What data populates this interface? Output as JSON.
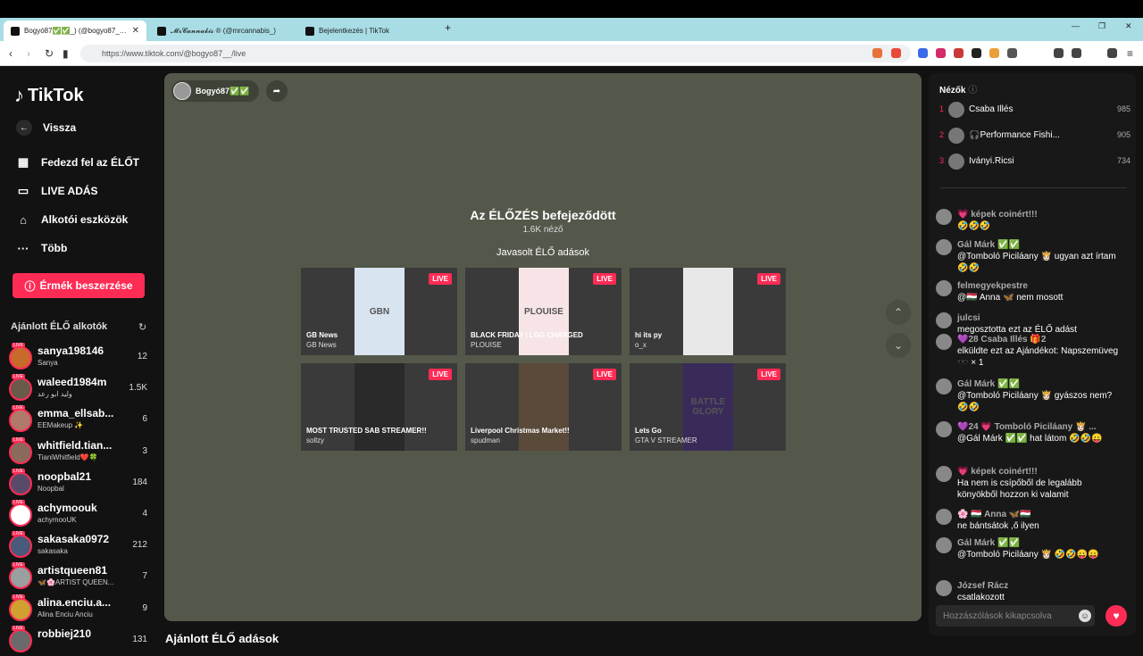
{
  "browser": {
    "tabs": [
      {
        "label": "Bogyó87✅✅_) (@bogyo87_) É"
      },
      {
        "label": "𝓜𝓻𝓒𝓪𝓷𝓷𝓪𝓫𝓲𝓼 ® (@mrcannabis_)"
      },
      {
        "label": "Bejelentkezés | TikTok"
      }
    ],
    "url": "https://www.tiktok.com/@bogyo87__/live"
  },
  "sidebar": {
    "logo": "TikTok",
    "back": "Vissza",
    "nav": [
      "Fedezd fel az ÉLŐT",
      "LIVE ADÁS",
      "Alkotói eszközök",
      "Több"
    ],
    "coins_button": "Érmék beszerzése",
    "recommended_heading": "Ajánlott ÉLŐ alkotók",
    "creators": [
      {
        "name": "sanya198146",
        "sub": "Sanya",
        "count": "12",
        "color": "#c86a2a"
      },
      {
        "name": "waleed1984m",
        "sub": "وليد ابو رعد",
        "count": "1.5K",
        "color": "#6a5a4a"
      },
      {
        "name": "emma_ellsab...",
        "sub": "EEMakeup ✨",
        "count": "6",
        "color": "#b07a6a"
      },
      {
        "name": "whitfield.tian...",
        "sub": "TianiWhitfield❤️🍀",
        "count": "3",
        "color": "#8a6a5a"
      },
      {
        "name": "noopbal21",
        "sub": "Noopbal",
        "count": "184",
        "color": "#5a4a6a"
      },
      {
        "name": "achymoouk",
        "sub": "achymooUK",
        "count": "4",
        "color": "#ffffff"
      },
      {
        "name": "sakasaka0972",
        "sub": "sakasaka",
        "count": "212",
        "color": "#4a5a7a"
      },
      {
        "name": "artistqueen81",
        "sub": "🦋🌸ARTIST QUEEN...",
        "count": "7",
        "color": "#9aa0a0"
      },
      {
        "name": "alina.enciu.a...",
        "sub": "Alina Enciu Anciu",
        "count": "9",
        "color": "#d0a030"
      },
      {
        "name": "robbiej210",
        "sub": "",
        "count": "131",
        "color": "#6a6a6a"
      }
    ]
  },
  "player": {
    "host_name": "Bogyó87✅✅",
    "ended_title": "Az ÉLŐZÉS befejeződött",
    "viewers": "1.6K néző",
    "suggested_heading": "Javasolt ÉLŐ adások",
    "live_label": "LIVE",
    "cards": [
      {
        "title": "GB News",
        "sub": "GB News",
        "color": "#d8e4f0",
        "thumbtext": "GBN"
      },
      {
        "title": "BLACK FRIDAY | LGG CHARGED",
        "sub": "PLOUISE",
        "color": "#f6e4e6",
        "thumbtext": "PLOUISE"
      },
      {
        "title": "hi its py",
        "sub": "o_x",
        "color": "#e8e8e8",
        "thumbtext": ""
      },
      {
        "title": "MOST TRUSTED SAB STREAMER!!",
        "sub": "sollzy",
        "color": "#2a2a2a",
        "thumbtext": ""
      },
      {
        "title": "Liverpool Christmas Market!!",
        "sub": "spudman",
        "color": "#5a4a3a",
        "thumbtext": ""
      },
      {
        "title": "Lets Go",
        "sub": "GTA V STREAMER",
        "color": "#3a2a5a",
        "thumbtext": "BATTLE GLORY"
      }
    ]
  },
  "bottom_heading": "Ajánlott ÉLŐ adások",
  "chat": {
    "viewers_heading": "Nézők",
    "top_viewers": [
      {
        "rank": "1",
        "name": "Csaba Illés",
        "count": "985"
      },
      {
        "rank": "2",
        "name": "🎧Performance Fishi...",
        "count": "905"
      },
      {
        "rank": "3",
        "name": "Iványi.Ricsi",
        "count": "734"
      }
    ],
    "messages": [
      {
        "name": "💗 képek coinért!!!",
        "text": "🤣🤣🤣"
      },
      {
        "name": "Gál Márk ✅✅",
        "text": "@Tomboló Piciláany 👸🏻 ugyan azt írtam 🤣🤣"
      },
      {
        "name": "felmegyekpestre",
        "text": "@🇭🇺 Anna 🦋 nem mosott"
      },
      {
        "name": "julcsi",
        "text": "megosztotta ezt az ÉLŐ adást"
      },
      {
        "name": "💜28 Csaba Illés 🎁2",
        "text": "elküldte ezt az Ajándékot: Napszemüveg 🕶️ × 1"
      },
      {
        "name": "Gál Márk ✅✅",
        "text": "@Tomboló Piciláany 👸🏻 gyászos nem? 🤣🤣"
      },
      {
        "name": "💜24 💗 Tomboló Piciláany 👸🏻 ...",
        "text": "@Gál Márk ✅✅ hat látom 🤣🤣😛"
      },
      {
        "name": "💗 képek coinért!!!",
        "text": "Ha nem is csípőből de legalább könyökből hozzon ki valamit"
      },
      {
        "name": "🌸 🇭🇺 Anna 🦋🇭🇺",
        "text": "ne bántsátok ,ő ilyen"
      },
      {
        "name": "Gál Márk ✅✅",
        "text": "@Tomboló Piciláany 👸🏻 🤣🤣😛😛"
      },
      {
        "name": "József Rácz",
        "text": "csatlakozott"
      }
    ],
    "compose_placeholder": "Hozzászólások kikapcsolva"
  }
}
